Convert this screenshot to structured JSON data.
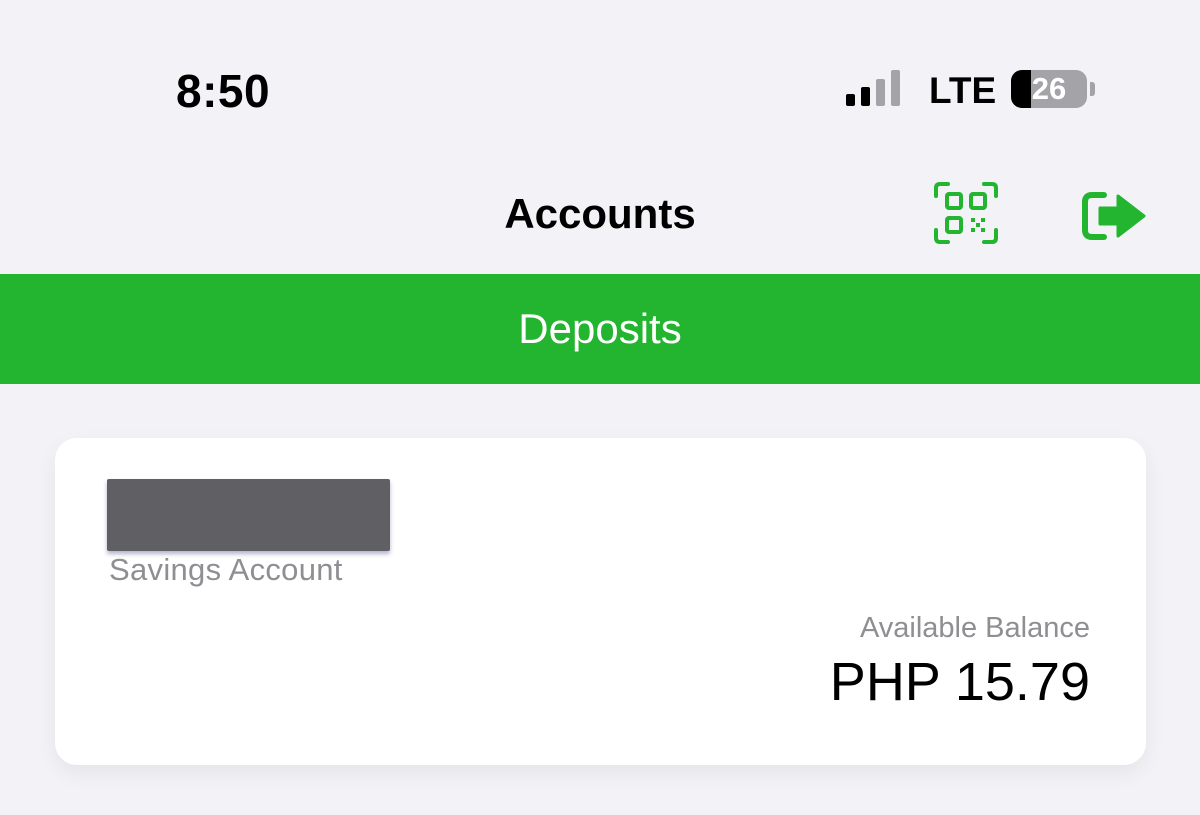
{
  "status_bar": {
    "time": "8:50",
    "network": "LTE",
    "signal_bars_active": 2,
    "signal_bars_total": 4,
    "battery_percent": 26,
    "battery_label": "26"
  },
  "nav": {
    "title": "Accounts",
    "qr_icon": "qr-code-icon",
    "logout_icon": "logout-icon"
  },
  "tab": {
    "label": "Deposits"
  },
  "account": {
    "type": "Savings Account",
    "balance_label": "Available Balance",
    "balance": "PHP 15.79"
  },
  "colors": {
    "accent": "#23b52f",
    "background": "#f2f2f7",
    "card": "#ffffff",
    "muted_text": "#8e8e93"
  }
}
